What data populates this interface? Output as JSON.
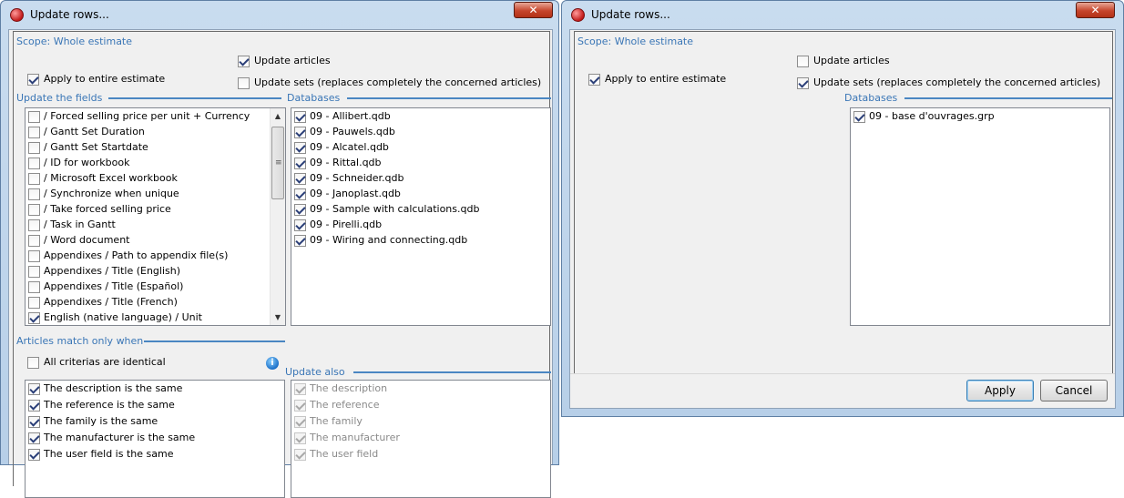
{
  "left_window": {
    "title": "Update rows...",
    "close_glyph": "✕",
    "scope": "Scope: Whole estimate",
    "apply_entire": {
      "label": "Apply to entire estimate",
      "checked": true
    },
    "update_articles": {
      "label": "Update articles",
      "checked": true
    },
    "update_sets": {
      "label": "Update sets (replaces completely the concerned articles)",
      "checked": false
    },
    "fields_header": "Update the fields",
    "fields": [
      {
        "label": "/ Forced selling price per unit + Currency",
        "checked": false
      },
      {
        "label": "/ Gantt Set Duration",
        "checked": false
      },
      {
        "label": "/ Gantt Set Startdate",
        "checked": false
      },
      {
        "label": "/ ID for workbook",
        "checked": false
      },
      {
        "label": "/ Microsoft Excel workbook",
        "checked": false
      },
      {
        "label": "/ Synchronize when unique",
        "checked": false
      },
      {
        "label": "/ Take forced selling price",
        "checked": false
      },
      {
        "label": "/ Task in Gantt",
        "checked": false
      },
      {
        "label": "/ Word document",
        "checked": false
      },
      {
        "label": "Appendixes / Path to appendix file(s)",
        "checked": false
      },
      {
        "label": "Appendixes / Title (English)",
        "checked": false
      },
      {
        "label": "Appendixes / Title (Español)",
        "checked": false
      },
      {
        "label": "Appendixes / Title (French)",
        "checked": false
      },
      {
        "label": "English (native language) / Unit",
        "checked": true
      }
    ],
    "databases_header": "Databases",
    "databases": [
      {
        "label": "09 - Allibert.qdb",
        "checked": true
      },
      {
        "label": "09 - Pauwels.qdb",
        "checked": true
      },
      {
        "label": "09 - Alcatel.qdb",
        "checked": true
      },
      {
        "label": "09 - Rittal.qdb",
        "checked": true
      },
      {
        "label": "09 - Schneider.qdb",
        "checked": true
      },
      {
        "label": "09 - Janoplast.qdb",
        "checked": true
      },
      {
        "label": "09 - Sample with calculations.qdb",
        "checked": true
      },
      {
        "label": "09 - Pirelli.qdb",
        "checked": true
      },
      {
        "label": "09 - Wiring and connecting.qdb",
        "checked": true
      }
    ],
    "match_header": "Articles match only when",
    "all_criterias": {
      "label": "All criterias are identical",
      "checked": false
    },
    "criteria": [
      {
        "label": "The description is the same",
        "checked": true
      },
      {
        "label": "The reference is the same",
        "checked": true
      },
      {
        "label": "The family is the same",
        "checked": true
      },
      {
        "label": "The manufacturer is the same",
        "checked": true
      },
      {
        "label": "The user field is the same",
        "checked": true
      }
    ],
    "update_also_header": "Update also",
    "update_also": [
      {
        "label": "The description",
        "checked": true
      },
      {
        "label": "The reference",
        "checked": true
      },
      {
        "label": "The family",
        "checked": true
      },
      {
        "label": "The manufacturer",
        "checked": true
      },
      {
        "label": "The user field",
        "checked": true
      }
    ],
    "info_glyph": "i"
  },
  "right_window": {
    "title": "Update rows...",
    "close_glyph": "✕",
    "scope": "Scope: Whole estimate",
    "apply_entire": {
      "label": "Apply to entire estimate",
      "checked": true
    },
    "update_articles": {
      "label": "Update articles",
      "checked": false
    },
    "update_sets": {
      "label": "Update sets (replaces completely the concerned articles)",
      "checked": true
    },
    "databases_header": "Databases",
    "databases": [
      {
        "label": "09 - base d'ouvrages.grp",
        "checked": true
      }
    ],
    "apply_label": "Apply",
    "cancel_label": "Cancel"
  },
  "colors": {
    "section_blue": "#3a76b6",
    "close_red": "#c6452c"
  }
}
